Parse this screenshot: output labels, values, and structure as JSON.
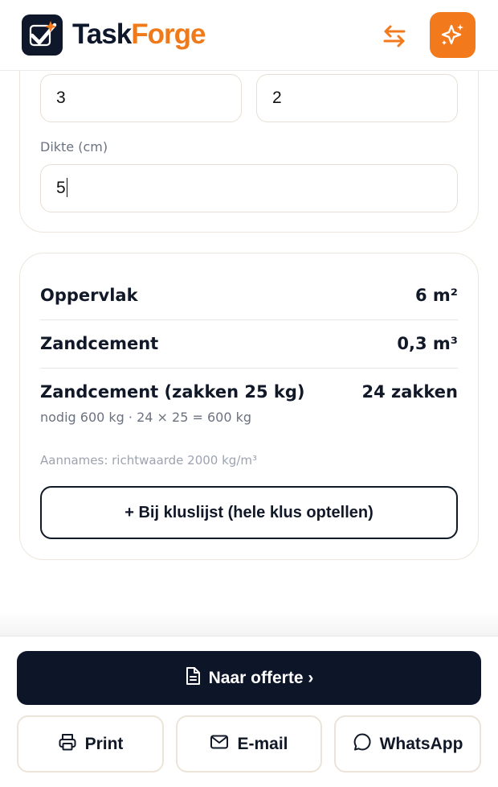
{
  "header": {
    "brand_part1": "Task",
    "brand_part2": "Forge",
    "colors": {
      "accent": "#f27a1d",
      "dark": "#0f172a"
    },
    "icons": {
      "logo": "checkbox-spark-icon",
      "swap": "swap-arrows-icon",
      "assistant": "sparkles-icon"
    }
  },
  "inputs": {
    "length_value": "3",
    "width_value": "2",
    "thickness_label": "Dikte (cm)",
    "thickness_value": "5"
  },
  "results": {
    "rows": [
      {
        "label": "Oppervlak",
        "value": "6 m²"
      },
      {
        "label": "Zandcement",
        "value": "0,3 m³"
      },
      {
        "label": "Zandcement (zakken 25 kg)",
        "value": "24 zakken",
        "sub": "nodig 600 kg · 24 × 25 = 600 kg"
      }
    ],
    "assumptions": "Aannames: richtwaarde 2000 kg/m³",
    "add_button": "+ Bij kluslijst (hele klus optellen)"
  },
  "footer": {
    "quote_button": "Naar offerte ›",
    "print_button": "Print",
    "email_button": "E-mail",
    "whatsapp_button": "WhatsApp",
    "icons": {
      "quote": "document-icon",
      "print": "printer-icon",
      "email": "mail-icon",
      "whatsapp": "chat-bubble-icon"
    }
  }
}
